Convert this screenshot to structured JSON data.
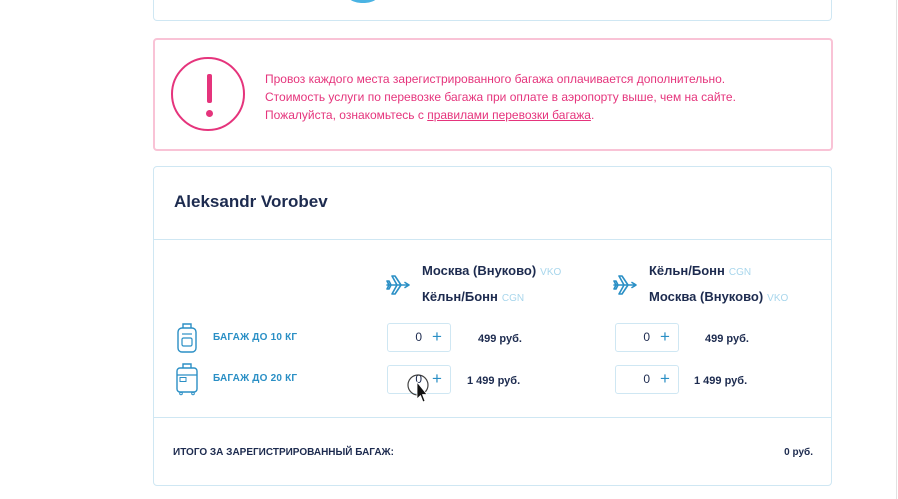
{
  "warning": {
    "line1": "Провоз каждого места зарегистрированного багажа оплачивается дополнительно.",
    "line2": "Стоимость услуги по перевозке багажа при оплате в аэропорту выше, чем на сайте.",
    "line3_prefix": "Пожалуйста, ознакомьтесь с ",
    "link_text": "правилами перевозки багажа",
    "line3_suffix": ".",
    "icon": "exclamation-icon"
  },
  "passenger": {
    "name": "Aleksandr Vorobev",
    "routes": [
      {
        "from_city": "Москва (Внуково)",
        "from_code": "VKO",
        "to_city": "Кёльн/Бонн",
        "to_code": "CGN"
      },
      {
        "from_city": "Кёльн/Бонн",
        "from_code": "CGN",
        "to_city": "Москва (Внуково)",
        "to_code": "VKO"
      }
    ],
    "baggage": [
      {
        "label": "БАГАЖ ДО 10 КГ",
        "icon": "backpack-icon",
        "route1": {
          "count": "0",
          "price": "499 руб."
        },
        "route2": {
          "count": "0",
          "price": "499 руб."
        }
      },
      {
        "label": "БАГАЖ ДО 20 КГ",
        "icon": "suitcase-icon",
        "route1": {
          "count": "0",
          "price": "1 499 руб."
        },
        "route2": {
          "count": "0",
          "price": "1 499 руб."
        }
      }
    ],
    "plus_symbol": "+",
    "total_label": "ИТОГО ЗА ЗАРЕГИСТРИРОВАННЫЙ БАГАЖ:",
    "total_value": "0 руб."
  },
  "colors": {
    "warning_accent": "#e5347c",
    "link_blue": "#2a8fc5",
    "text_dark": "#1d2b4f",
    "border_light": "#cfe7f3",
    "code_muted": "#a8d6ec"
  }
}
